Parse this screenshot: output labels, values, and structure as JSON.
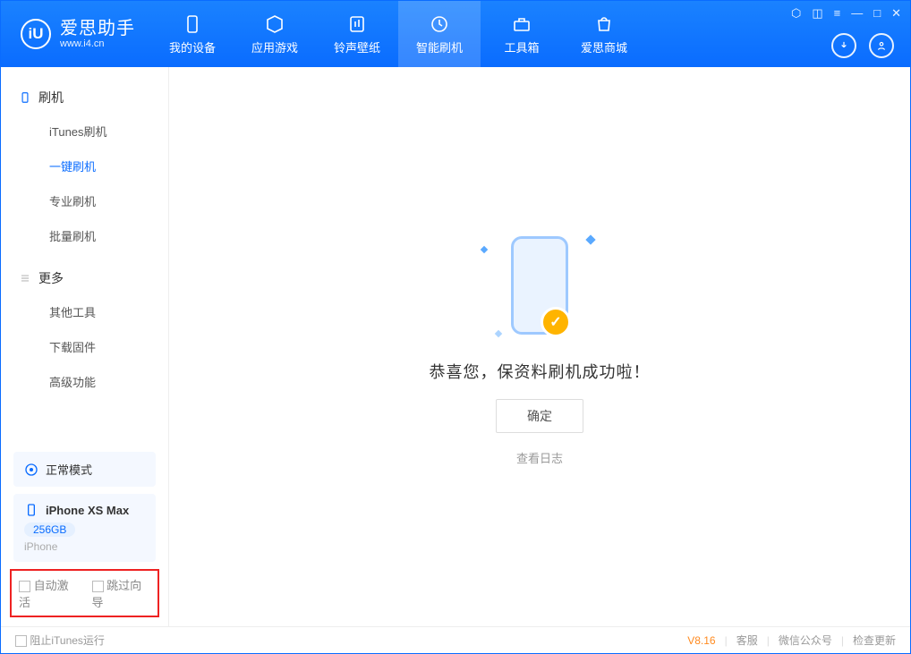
{
  "app": {
    "name": "爱思助手",
    "domain": "www.i4.cn",
    "logo_letter": "iU"
  },
  "nav": {
    "device": "我的设备",
    "apps": "应用游戏",
    "rings": "铃声壁纸",
    "flash": "智能刷机",
    "tools": "工具箱",
    "store": "爱思商城"
  },
  "sidebar": {
    "flash_title": "刷机",
    "itunes": "iTunes刷机",
    "oneclick": "一键刷机",
    "pro": "专业刷机",
    "batch": "批量刷机",
    "more_title": "更多",
    "other": "其他工具",
    "firmware": "下载固件",
    "advanced": "高级功能"
  },
  "mode_card": {
    "label": "正常模式"
  },
  "device_card": {
    "name": "iPhone XS Max",
    "storage": "256GB",
    "type": "iPhone"
  },
  "options": {
    "auto_activate": "自动激活",
    "skip_guide": "跳过向导"
  },
  "main": {
    "message": "恭喜您，保资料刷机成功啦！",
    "ok": "确定",
    "view_log": "查看日志"
  },
  "footer": {
    "block_itunes": "阻止iTunes运行",
    "version": "V8.16",
    "support": "客服",
    "wechat": "微信公众号",
    "update": "检查更新"
  }
}
